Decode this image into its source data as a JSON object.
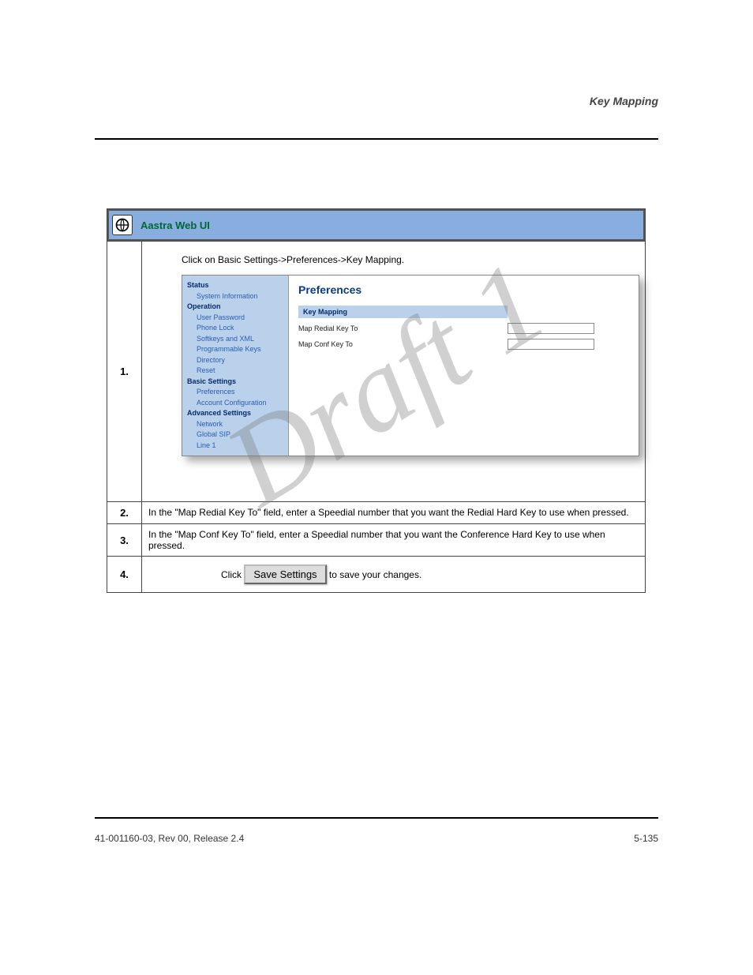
{
  "header": {
    "doc_title": "Key Mapping",
    "intro": "Click on Basic Settings->Preferences->Key Mapping."
  },
  "config": {
    "sidebar": {
      "status_label": "Status",
      "system_info": "System Information",
      "operation_label": "Operation",
      "user_password": "User Password",
      "phone_lock": "Phone Lock",
      "softkeys_xml": "Softkeys and XML",
      "prog_keys": "Programmable Keys",
      "directory": "Directory",
      "reset": "Reset",
      "basic_settings_label": "Basic Settings",
      "preferences": "Preferences",
      "account_config": "Account Configuration",
      "advanced_label": "Advanced Settings",
      "network": "Network",
      "global_sip": "Global SIP",
      "line1": "Line 1"
    },
    "content": {
      "title": "Preferences",
      "section_header": "Key Mapping",
      "redial_label": "Map Redial Key To",
      "conf_label": "Map Conf Key To",
      "redial_value": "",
      "conf_value": ""
    }
  },
  "rows": {
    "step_label": "Aastra Web UI",
    "row3": "In the \"Map Redial Key To\" field, enter a Speedial number that you want the Redial Hard Key to use when pressed.",
    "row4": "In the \"Map Conf Key To\" field, enter a Speedial number that you want the Conference Hard Key to use when pressed.",
    "row5_prefix": "Click ",
    "row5_suffix": " to save your changes.",
    "save_btn": "Save Settings"
  },
  "watermark": "Draft 1",
  "footer": {
    "left": "41-001160-03, Rev 00, Release 2.4",
    "right": "5-135"
  },
  "numbers": {
    "n1": "1.",
    "n2": "2.",
    "n3": "3.",
    "n4": "4."
  }
}
